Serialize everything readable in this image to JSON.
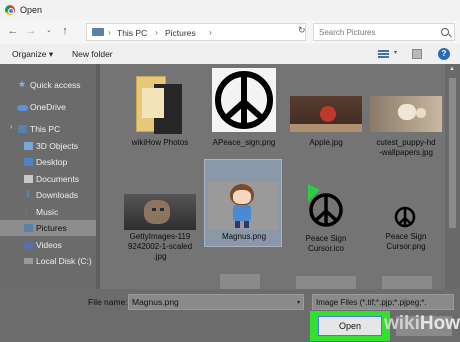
{
  "window": {
    "title": "Open"
  },
  "nav": {
    "breadcrumb": [
      "This PC",
      "Pictures"
    ],
    "search_placeholder": "Search Pictures"
  },
  "toolbar": {
    "organize": "Organize",
    "new_folder": "New folder"
  },
  "sidebar": {
    "items": [
      {
        "label": "Quick access",
        "icon": "star-icon"
      },
      {
        "label": "OneDrive",
        "icon": "cloud-icon"
      },
      {
        "label": "This PC",
        "icon": "computer-icon"
      },
      {
        "label": "3D Objects",
        "icon": "cube-icon"
      },
      {
        "label": "Desktop",
        "icon": "desktop-icon"
      },
      {
        "label": "Documents",
        "icon": "documents-icon"
      },
      {
        "label": "Downloads",
        "icon": "downloads-icon"
      },
      {
        "label": "Music",
        "icon": "music-icon"
      },
      {
        "label": "Pictures",
        "icon": "pictures-icon",
        "selected": true
      },
      {
        "label": "Videos",
        "icon": "videos-icon"
      },
      {
        "label": "Local Disk (C:)",
        "icon": "drive-icon"
      }
    ]
  },
  "files": [
    {
      "name": "wikiHow Photos",
      "kind": "folder"
    },
    {
      "name": "APeace_sign.png",
      "kind": "peace-large"
    },
    {
      "name": "Apple.jpg",
      "kind": "apple"
    },
    {
      "name": "cutest_puppy-hd\n-wallpapers.jpg",
      "kind": "puppy"
    },
    {
      "name": "GettyImages-119\n9242002-1-scaled\n.jpg",
      "kind": "cat"
    },
    {
      "name": "Magnus.png",
      "kind": "cartoon",
      "selected": true
    },
    {
      "name": "Peace Sign\nCursor.ico",
      "kind": "peace-cursor-ico"
    },
    {
      "name": "Peace Sign\nCursor.png",
      "kind": "peace-cursor-png"
    }
  ],
  "bottom": {
    "file_name_label": "File name:",
    "file_name_value": "Magnus.png",
    "filter": "Image Files (*.tif;*.pjp;*.pjpeg;*.",
    "open_label": "Open",
    "cancel_label": ""
  },
  "watermark": {
    "wiki": "wiki",
    "how": "How"
  },
  "colors": {
    "highlight": "#33e02f",
    "selection": "#8b98a7"
  }
}
